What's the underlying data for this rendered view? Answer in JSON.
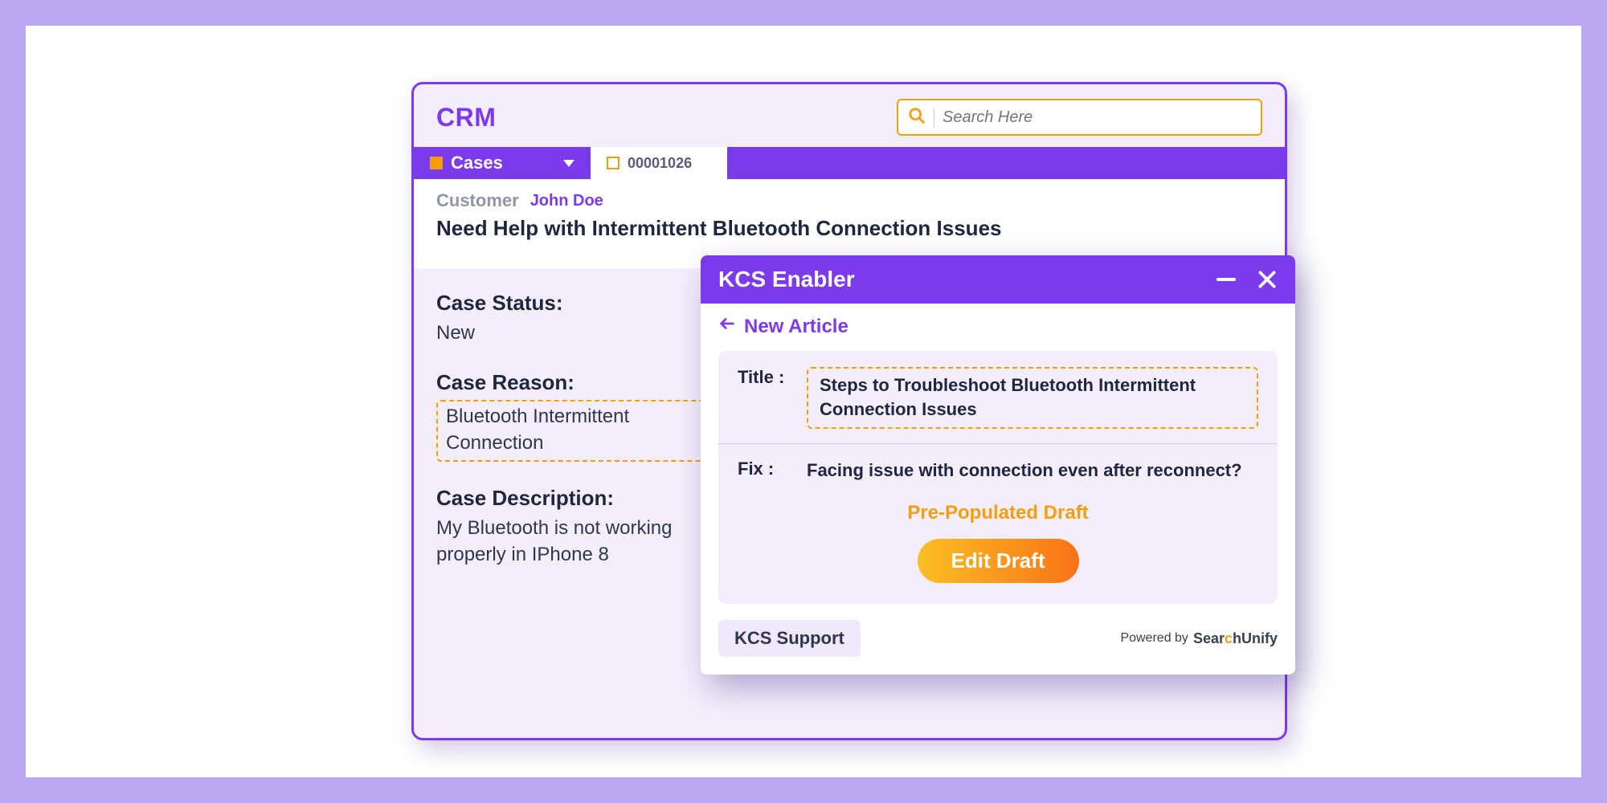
{
  "app": {
    "title": "CRM"
  },
  "search": {
    "placeholder": "Search Here"
  },
  "tabs": {
    "filter_label": "Cases",
    "case_number": "00001026"
  },
  "case": {
    "customer_label": "Customer",
    "customer_name": "John Doe",
    "title": "Need Help with Intermittent Bluetooth Connection Issues",
    "status_label": "Case Status:",
    "status_value": "New",
    "reason_label": "Case Reason:",
    "reason_value": "Bluetooth Intermittent Connection",
    "description_label": "Case Description:",
    "description_value": "My Bluetooth is not working properly in IPhone 8"
  },
  "kcs": {
    "panel_title": "KCS Enabler",
    "breadcrumb": "New Article",
    "title_key": "Title :",
    "title_value": "Steps to Troubleshoot Bluetooth Intermittent Connection Issues",
    "fix_key": "Fix :",
    "fix_value": "Facing issue with connection even after reconnect?",
    "draft_label": "Pre-Populated Draft",
    "edit_button": "Edit Draft",
    "support_label": "KCS Support",
    "powered_by": "Powered by",
    "brand_a": "Sear",
    "brand_b": "c",
    "brand_c": "hUnify"
  }
}
